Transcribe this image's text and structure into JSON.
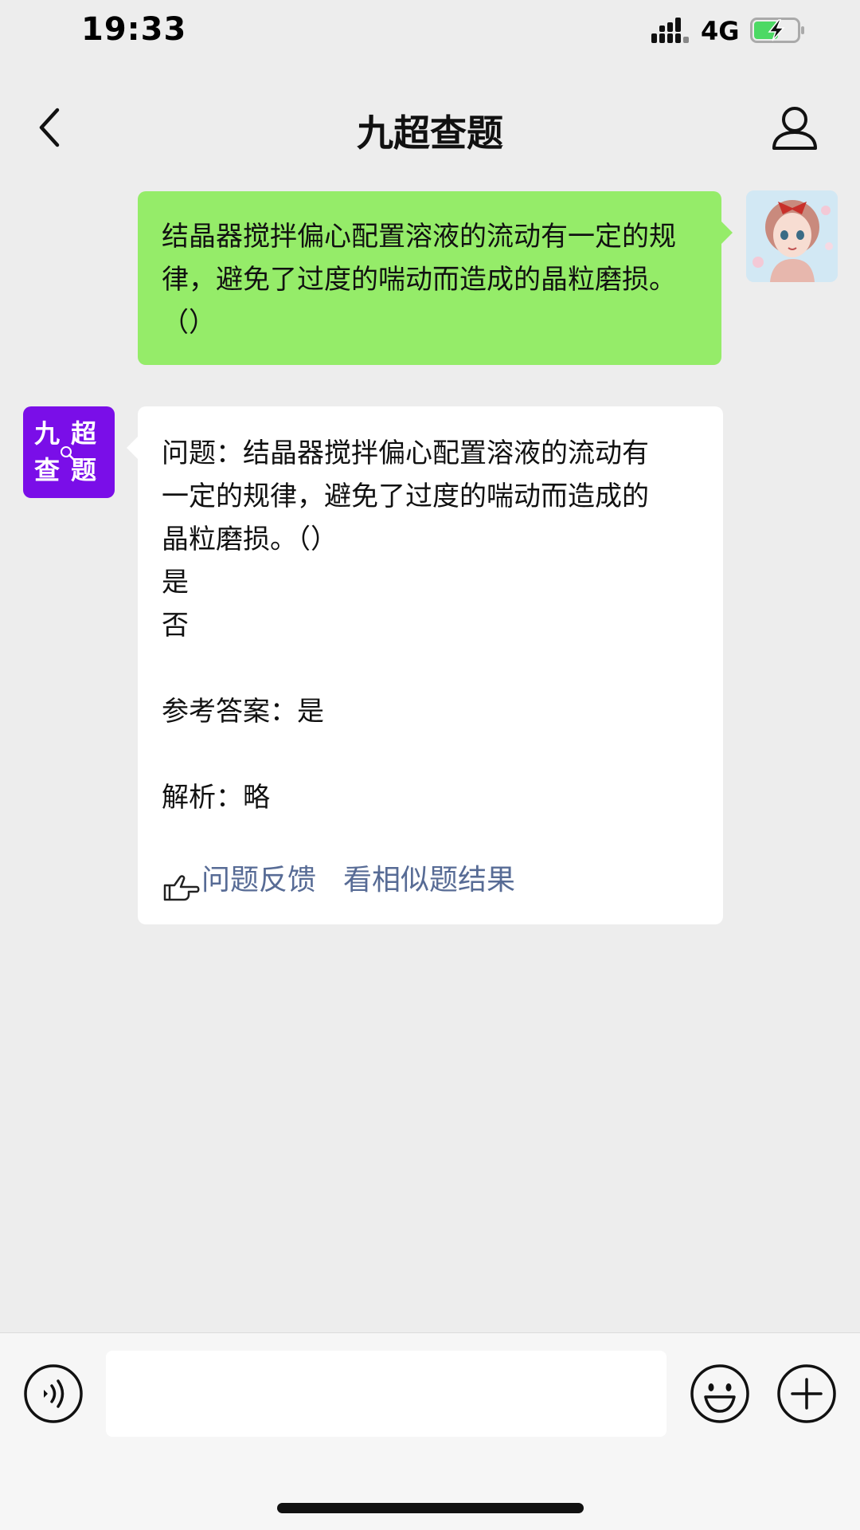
{
  "status_bar": {
    "time": "19:33",
    "network": "4G",
    "icons": [
      "signal-icon",
      "battery-charging-icon"
    ]
  },
  "header": {
    "title": "九超查题",
    "icons": [
      "back-icon",
      "user-icon"
    ]
  },
  "messages": {
    "question": {
      "text": "结晶器搅拌偏心配置溶液的流动有一定的规律，避免了过度的喘动而造成的晶粒磨损。（）"
    },
    "answer": {
      "bot_avatar": [
        "九",
        "超",
        "查",
        "题"
      ],
      "lines": [
        "问题：结晶器搅拌偏心配置溶液的流动有",
        "一定的规律，避免了过度的喘动而造成的",
        "晶粒磨损。（）",
        "是",
        "否"
      ],
      "reference": "参考答案：是",
      "analysis": "解析：略",
      "feedback_link": "问题反馈",
      "similar_link": "看相似题结果"
    }
  },
  "input_bar": {
    "placeholder": "",
    "icons": [
      "voice-icon",
      "emoji-icon",
      "plus-icon"
    ]
  },
  "colors": {
    "background": "#ededed",
    "outgoing_bubble": "#95ec69",
    "incoming_bubble": "#ffffff",
    "bot_avatar": "#7a0ee8",
    "link": "#576b95"
  }
}
